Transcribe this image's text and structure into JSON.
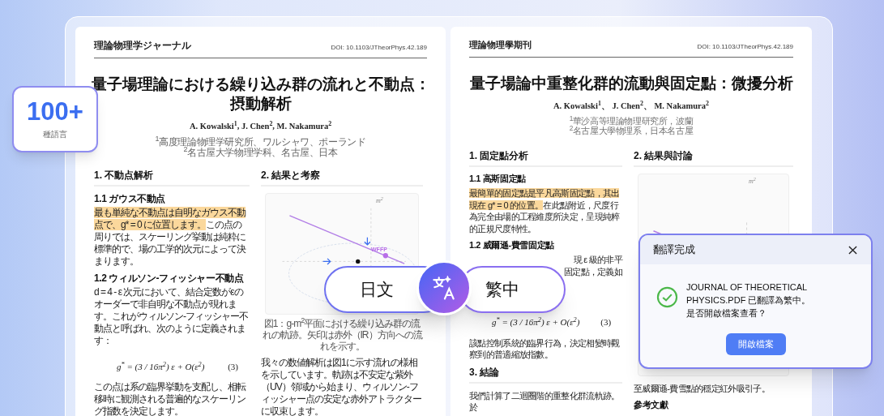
{
  "badge": {
    "count": "100+",
    "label": "種語言"
  },
  "documents": [
    {
      "journal": "理論物理学ジャーナル",
      "doi": "DOI: 10.1103/JTheorPhys.42.189",
      "title": "量子場理論における繰り込み群の流れと不動点：摂動解析",
      "authors": "A. Kowalski$^{1}$, J. Chen$^{2}$, M. Nakamura$^{2}$",
      "affiliations": [
        "$^{1}$高度理論物理学研究所、ワルシャワ、ポーランド",
        "$^{2}$名古屋大学物理学科、名古屋、日本"
      ],
      "columns": [
        {
          "blocks": [
            {
              "kind": "heading",
              "text": "1. 不動点解析"
            },
            {
              "kind": "subheading",
              "text": "1.1 ガウス不動点"
            },
            {
              "kind": "paragraph",
              "highlight": "最も単純な不動点は自明なガウス不動点で、g* = 0 に位置します。",
              "text": "この点の周りでは、スケーリング挙動は純粋に標準的で、場の工学的次元によって決まります。"
            },
            {
              "kind": "subheading",
              "text": "1.2 ウィルソン-フィッシャー不動点"
            },
            {
              "kind": "paragraph",
              "text": "d = 4 - ε 次元において、結合定数がεのオーダーで非自明な不動点が現れます。これがウィルソン-フィッシャー不動点と呼ばれ、次のように定義されます："
            },
            {
              "kind": "equation",
              "formula": "g$^{*}$ = (3 / 16π$^{2}$) ε + O(ε$^{2}$)",
              "number": "(3)"
            },
            {
              "kind": "paragraph",
              "text": "この点は系の臨界挙動を支配し、相転移時に観測される普遍的なスケーリング指数を決定します。"
            }
          ]
        },
        {
          "blocks": [
            {
              "kind": "heading",
              "text": "2. 結果と考察"
            },
            {
              "kind": "figure",
              "axis_label": "m$^{2}$",
              "point_label": "WFFP",
              "caption": "図1：g-m$^{2}$平面における繰り込み群の流れの軌跡。矢印は赤外（IR）方向への流れを示す。"
            },
            {
              "kind": "paragraph",
              "text": "我々の数値解析は図1に示す流れの様相を示しています。軌跡は不安定な紫外（UV）領域から始まり、ウィルソン-フィッシャー点の安定な赤外アトラクターに収束します。"
            }
          ]
        }
      ]
    },
    {
      "journal": "理論物理學期刊",
      "doi": "DOI: 10.1103/JTheorPhys.42.189",
      "title": "量子場論中重整化群的流動與固定點：微擾分析",
      "authors": "A. Kowalski$^{1}$、 J. Chen$^{2}$、 M. Nakamura$^{2}$",
      "affiliations": [
        "$^{1}$華沙高等理論物理研究所，波蘭",
        "$^{2}$名古屋大學物理系，日本名古屋"
      ],
      "columns": [
        {
          "blocks": [
            {
              "kind": "heading",
              "text": "1. 固定點分析"
            },
            {
              "kind": "subheading",
              "text": "1.1 高斯固定點"
            },
            {
              "kind": "paragraph",
              "highlight": "最簡單的固定點是平凡高斯固定點，其出現在 g* = 0 的位置。",
              "text": "在此點附近，尺度行為完全由場的工程維度所決定，呈現純粹的正規尺度特性。"
            },
            {
              "kind": "subheading",
              "text": "1.2 威爾遜-費雪固定點"
            },
            {
              "kind": "fragment",
              "lines": [
                "現 ε 級的非平",
                "固定點，定義如"
              ]
            },
            {
              "kind": "equation",
              "formula": "g$^{*}$ = (3 / 16π$^{2}$) ε + O(ε$^{2}$)",
              "number": "(3)"
            },
            {
              "kind": "paragraph",
              "text": "該點控制系統的臨界行為，決定相變時觀察到的普適縮放指數。"
            },
            {
              "kind": "heading",
              "text": "3. 結論"
            },
            {
              "kind": "paragraph",
              "text": "我們計算了二迴圈階的重整化群流軌跡。於"
            }
          ]
        },
        {
          "blocks": [
            {
              "kind": "heading",
              "text": "2. 結果與討論"
            },
            {
              "kind": "figure",
              "axis_label": "m$^{2}$"
            },
            {
              "kind": "paragraph",
              "text": "至威爾遜-費雪點的穩定紅外吸引子。"
            },
            {
              "kind": "subheading",
              "text": "參考文獻"
            }
          ]
        }
      ]
    }
  ],
  "language_switch": {
    "source": "日文",
    "target": "繁中"
  },
  "dialog": {
    "title": "翻譯完成",
    "message": "JOURNAL OF THEORETICAL PHYSICS.PDF 已翻譯為繁中。",
    "question": "是否開啟檔案查看？",
    "button": "開啟檔案"
  }
}
